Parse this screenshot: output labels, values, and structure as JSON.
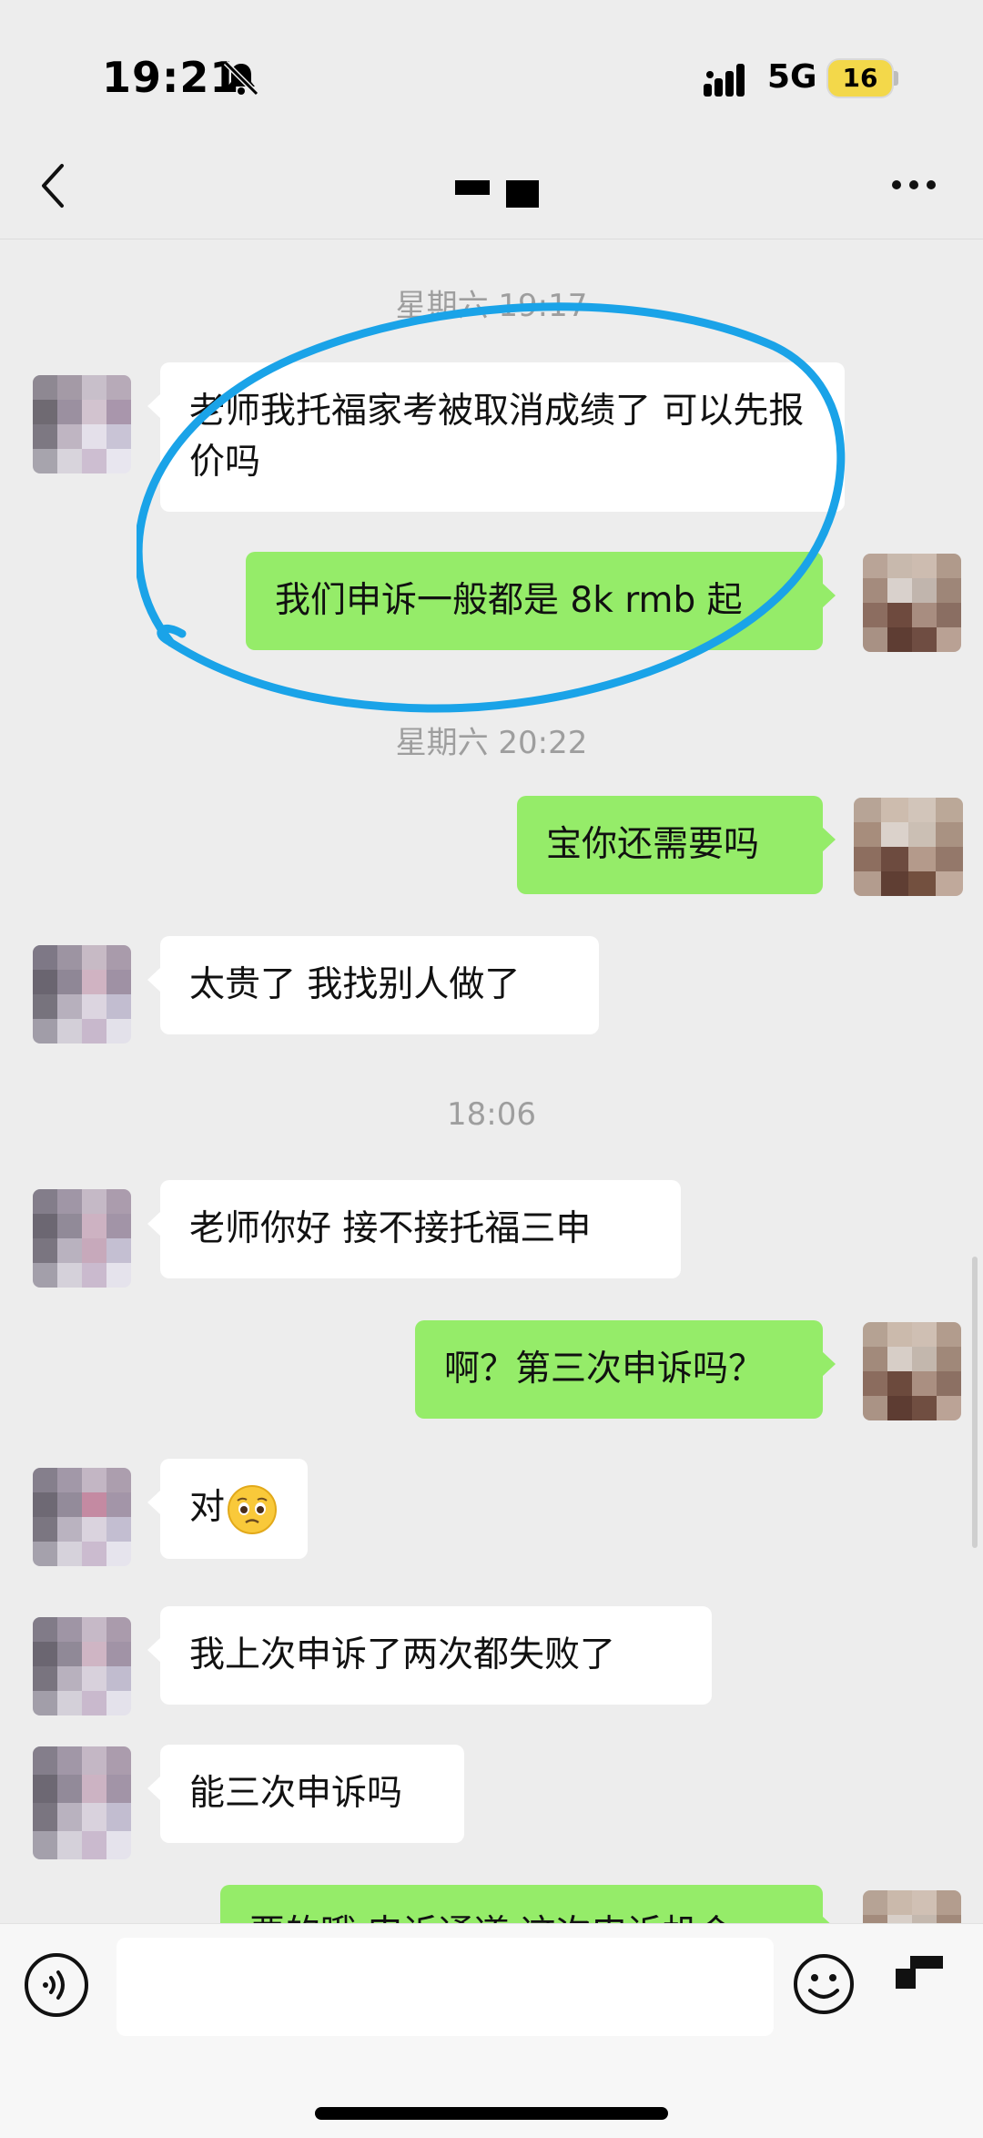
{
  "status_bar": {
    "time": "19:21",
    "network": "5G",
    "battery": "16"
  },
  "messages": {
    "ts1": "星期六 19:17",
    "m1": "老师我托福家考被取消成绩了 可以先报价吗",
    "m2": "我们申诉一般都是 8k rmb 起",
    "ts2": "星期六 20:22",
    "m3": "宝你还需要吗",
    "m4": "太贵了 我找别人做了",
    "ts3": "18:06",
    "m5": "老师你好 接不接托福三申",
    "m6": "啊？第三次申诉吗？",
    "m7": "对",
    "m8": "我上次申诉了两次都失败了",
    "m9": "能三次申诉吗",
    "m10": "要的哦  申诉通道  这次申诉机会"
  },
  "colors": {
    "incoming_bubble": "#ffffff",
    "outgoing_bubble": "#95ec69",
    "annotation": "#1aa3e8"
  },
  "icons": [
    "bell-muted-icon",
    "signal-icon",
    "back-icon",
    "more-icon",
    "voice-icon",
    "emoji-icon"
  ]
}
